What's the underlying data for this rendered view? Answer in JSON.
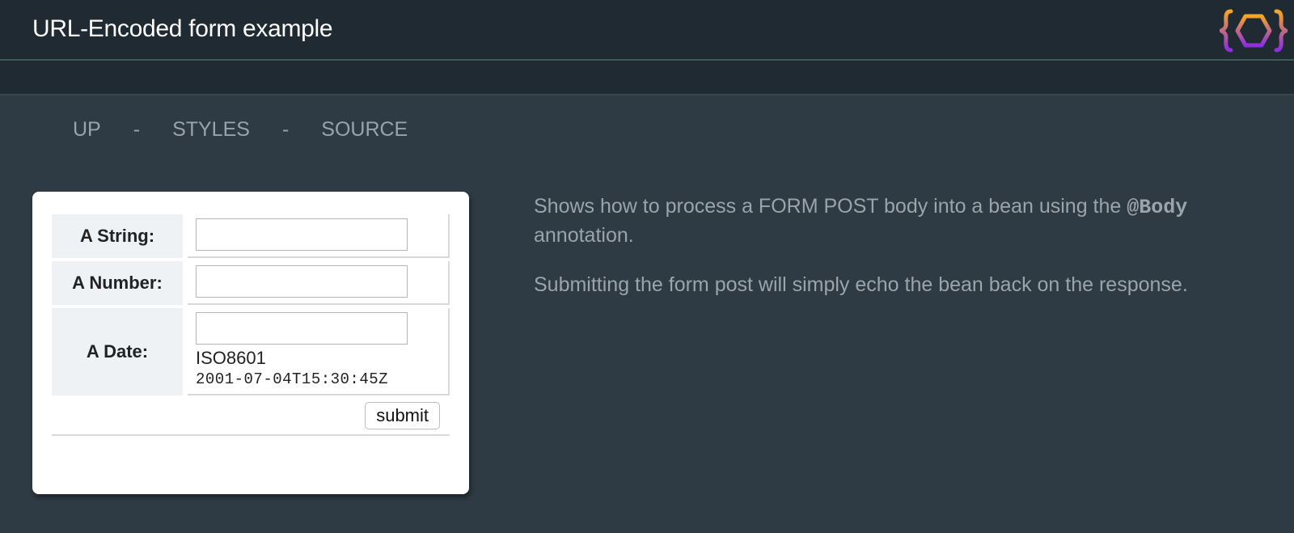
{
  "header": {
    "title": "URL-Encoded form example"
  },
  "nav": {
    "items": [
      {
        "label": "UP"
      },
      {
        "label": "STYLES"
      },
      {
        "label": "SOURCE"
      }
    ],
    "separator": "-"
  },
  "form": {
    "fields": [
      {
        "label": "A String:",
        "value": "",
        "placeholder": ""
      },
      {
        "label": "A Number:",
        "value": "",
        "placeholder": ""
      },
      {
        "label": "A Date:",
        "value": "",
        "placeholder": "",
        "hint_label": "ISO8601",
        "hint_example": "2001-07-04T15:30:45Z"
      }
    ],
    "submit_label": "submit"
  },
  "description": {
    "line1_before": "Shows how to process a FORM POST body into a bean using the ",
    "line1_code": "@Body",
    "line1_after": " annotation.",
    "line2": "Submitting the form post will simply echo the bean back on the response."
  },
  "colors": {
    "header_bg": "#1f2a33",
    "page_bg": "#2e3a44",
    "logo_orange": "#f5a623",
    "logo_purple": "#8e2de2"
  },
  "icons": {
    "logo": "juneau-logo-icon"
  }
}
